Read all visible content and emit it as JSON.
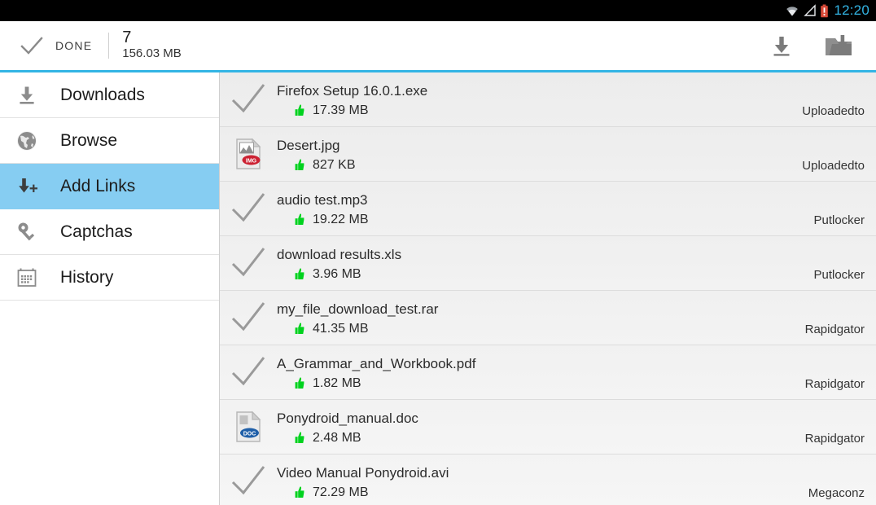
{
  "statusbar": {
    "time": "12:20",
    "icons": [
      "wifi-icon",
      "signal-icon",
      "battery-alert-icon"
    ],
    "accent_color": "#33b5e5",
    "background": "#000000"
  },
  "actionbar": {
    "done_label": "DONE",
    "done_icon": "check-icon",
    "selected_count": "7",
    "total_size": "156.03 MB",
    "actions": [
      {
        "name": "download-button",
        "icon": "download-icon"
      },
      {
        "name": "folder-download-button",
        "icon": "folder-download-icon"
      }
    ],
    "accent_underline": "#33b5e5"
  },
  "sidebar": {
    "items": [
      {
        "label": "Downloads",
        "icon": "download-icon",
        "active": false
      },
      {
        "label": "Browse",
        "icon": "globe-icon",
        "active": false
      },
      {
        "label": "Add Links",
        "icon": "add-link-icon",
        "active": true
      },
      {
        "label": "Captchas",
        "icon": "key-icon",
        "active": false
      },
      {
        "label": "History",
        "icon": "calendar-icon",
        "active": false
      }
    ],
    "active_color": "#86cdf2"
  },
  "list": {
    "status_icon_color": "#00d21e",
    "rows": [
      {
        "name": "Firefox Setup 16.0.1.exe",
        "size": "17.39 MB",
        "host": "Uploadedto",
        "icon": "check-icon",
        "status_icon": "thumbs-up-icon"
      },
      {
        "name": "Desert.jpg",
        "size": "827 KB",
        "host": "Uploadedto",
        "icon": "img-file-icon",
        "status_icon": "thumbs-up-icon"
      },
      {
        "name": "audio test.mp3",
        "size": "19.22 MB",
        "host": "Putlocker",
        "icon": "check-icon",
        "status_icon": "thumbs-up-icon"
      },
      {
        "name": "download results.xls",
        "size": "3.96 MB",
        "host": "Putlocker",
        "icon": "check-icon",
        "status_icon": "thumbs-up-icon"
      },
      {
        "name": "my_file_download_test.rar",
        "size": "41.35 MB",
        "host": "Rapidgator",
        "icon": "check-icon",
        "status_icon": "thumbs-up-icon"
      },
      {
        "name": "A_Grammar_and_Workbook.pdf",
        "size": "1.82 MB",
        "host": "Rapidgator",
        "icon": "check-icon",
        "status_icon": "thumbs-up-icon"
      },
      {
        "name": "Ponydroid_manual.doc",
        "size": "2.48 MB",
        "host": "Rapidgator",
        "icon": "doc-file-icon",
        "status_icon": "thumbs-up-icon"
      },
      {
        "name": "Video Manual Ponydroid.avi",
        "size": "72.29 MB",
        "host": "Megaconz",
        "icon": "check-icon",
        "status_icon": "thumbs-up-icon"
      }
    ]
  }
}
